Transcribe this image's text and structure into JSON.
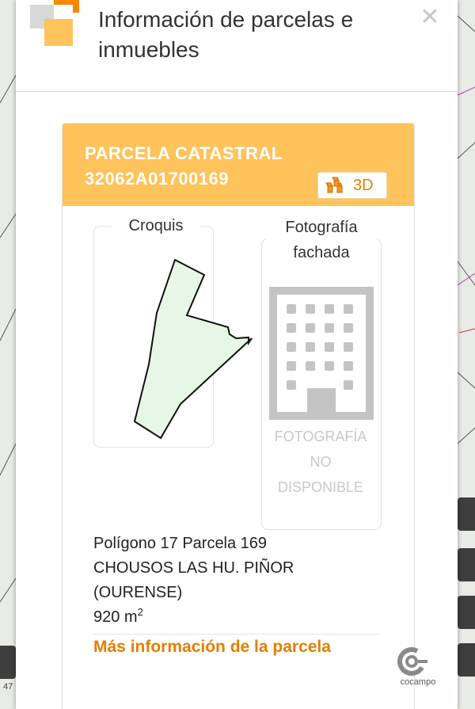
{
  "header": {
    "title": "Información de parcelas e inmuebles",
    "close_glyph": "✕"
  },
  "parcel": {
    "heading_line1": "PARCELA CATASTRAL",
    "heading_line2": "32062A01700169",
    "button_3d_label": "3D",
    "sketch_label": "Croquis",
    "photo_label": "Fotografía fachada",
    "photo_unavailable": [
      "FOTOGRAFÍA",
      "NO",
      "DISPONIBLE"
    ],
    "address_lines": [
      "Polígono 17 Parcela 169",
      "CHOUSOS LAS HU. PIÑOR",
      "(OURENSE)"
    ],
    "area_value": "920 m",
    "area_unit_sup": "2",
    "more_info_link": "Más información de la parcela",
    "brand_logo_text": "cocampo"
  },
  "map_overlay": {
    "left_edge_text": "47"
  },
  "colors": {
    "accent_orange": "#e67e00",
    "header_yellow": "#ffc35c",
    "sketch_fill": "#e6f7e6"
  },
  "icons": {
    "logo": "squares-logo-icon",
    "close": "close-icon",
    "cube": "cube-icon",
    "building": "building-icon",
    "brand": "cocampo-logo-icon"
  }
}
